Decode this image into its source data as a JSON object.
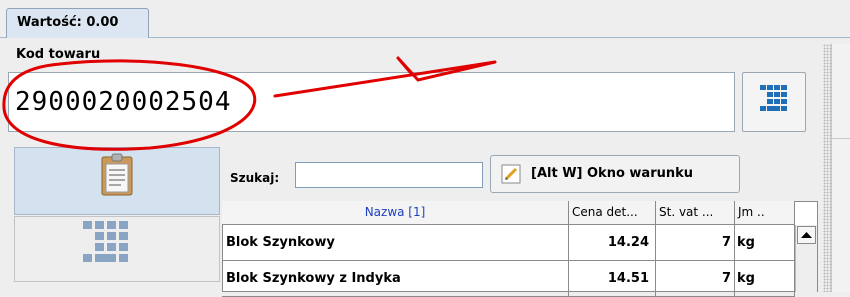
{
  "tab": {
    "label": "Wartość: 0.00"
  },
  "product_code": {
    "label": "Kod towaru",
    "value": "2900020002504"
  },
  "search": {
    "label": "Szukaj:",
    "value": ""
  },
  "condition_button": {
    "label": "[Alt W] Okno warunku"
  },
  "table": {
    "columns": [
      "Nazwa [1]",
      "Cena det...",
      "St. vat ...",
      "Jm .."
    ],
    "rows": [
      {
        "name": "Blok Szynkowy",
        "price": "14.24",
        "vat": "7",
        "unit": "kg"
      },
      {
        "name": "Blok Szynkowy z Indyka",
        "price": "14.51",
        "vat": "7",
        "unit": "kg"
      }
    ]
  },
  "icons": {
    "keyboard": "keypad-icon",
    "clipboard": "clipboard-icon",
    "pencil": "pencil-icon",
    "scroll_up": "arrow-up-icon"
  },
  "colors": {
    "annotation": "#e00000",
    "header_link": "#1f3fbf",
    "selected_tab": "#dbe6f2"
  }
}
